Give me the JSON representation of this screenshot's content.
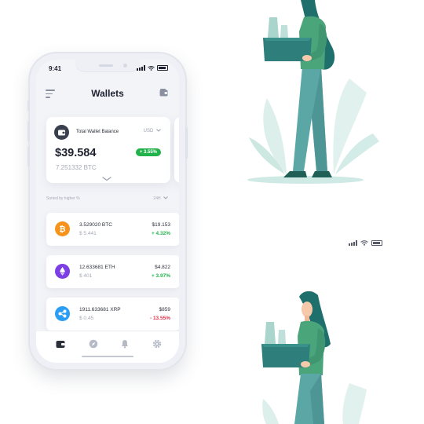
{
  "status": {
    "time": "9:41"
  },
  "header": {
    "title": "Wallets",
    "menu_icon": "menu-icon",
    "add_icon": "wallet-add-icon"
  },
  "balance": {
    "label": "Total Wallet Balance",
    "currency": "USD",
    "amount": "$39.584",
    "change": "+ 3.55%",
    "btc": "7.251332 BTC"
  },
  "list": {
    "sort_label": "Sorted by higher %",
    "period": "24H"
  },
  "coins": [
    {
      "amount": "3.529020 BTC",
      "usd": "$ 5.441",
      "price": "$19.153",
      "change": "+ 4.32%",
      "icon": "bitcoin-icon",
      "color": "#f7931a"
    },
    {
      "amount": "12.633681 ETH",
      "usd": "$ 401",
      "price": "$4.822",
      "change": "+ 3.97%",
      "icon": "ethereum-icon",
      "color": "#7b3fe4"
    },
    {
      "amount": "1911.633681 XRP",
      "usd": "$ 0.45",
      "price": "$859",
      "change": "- 13.55%",
      "icon": "ripple-icon",
      "color": "#2a9df4"
    }
  ],
  "tabs": [
    "wallet-icon",
    "compass-icon",
    "bell-icon",
    "settings-icon"
  ],
  "colors": {
    "positive": "#21b24b",
    "negative": "#e0324b",
    "accent_dark": "#3a3f4d",
    "illustration_teal": "#3a8f8b",
    "illustration_green": "#4aa57a"
  }
}
